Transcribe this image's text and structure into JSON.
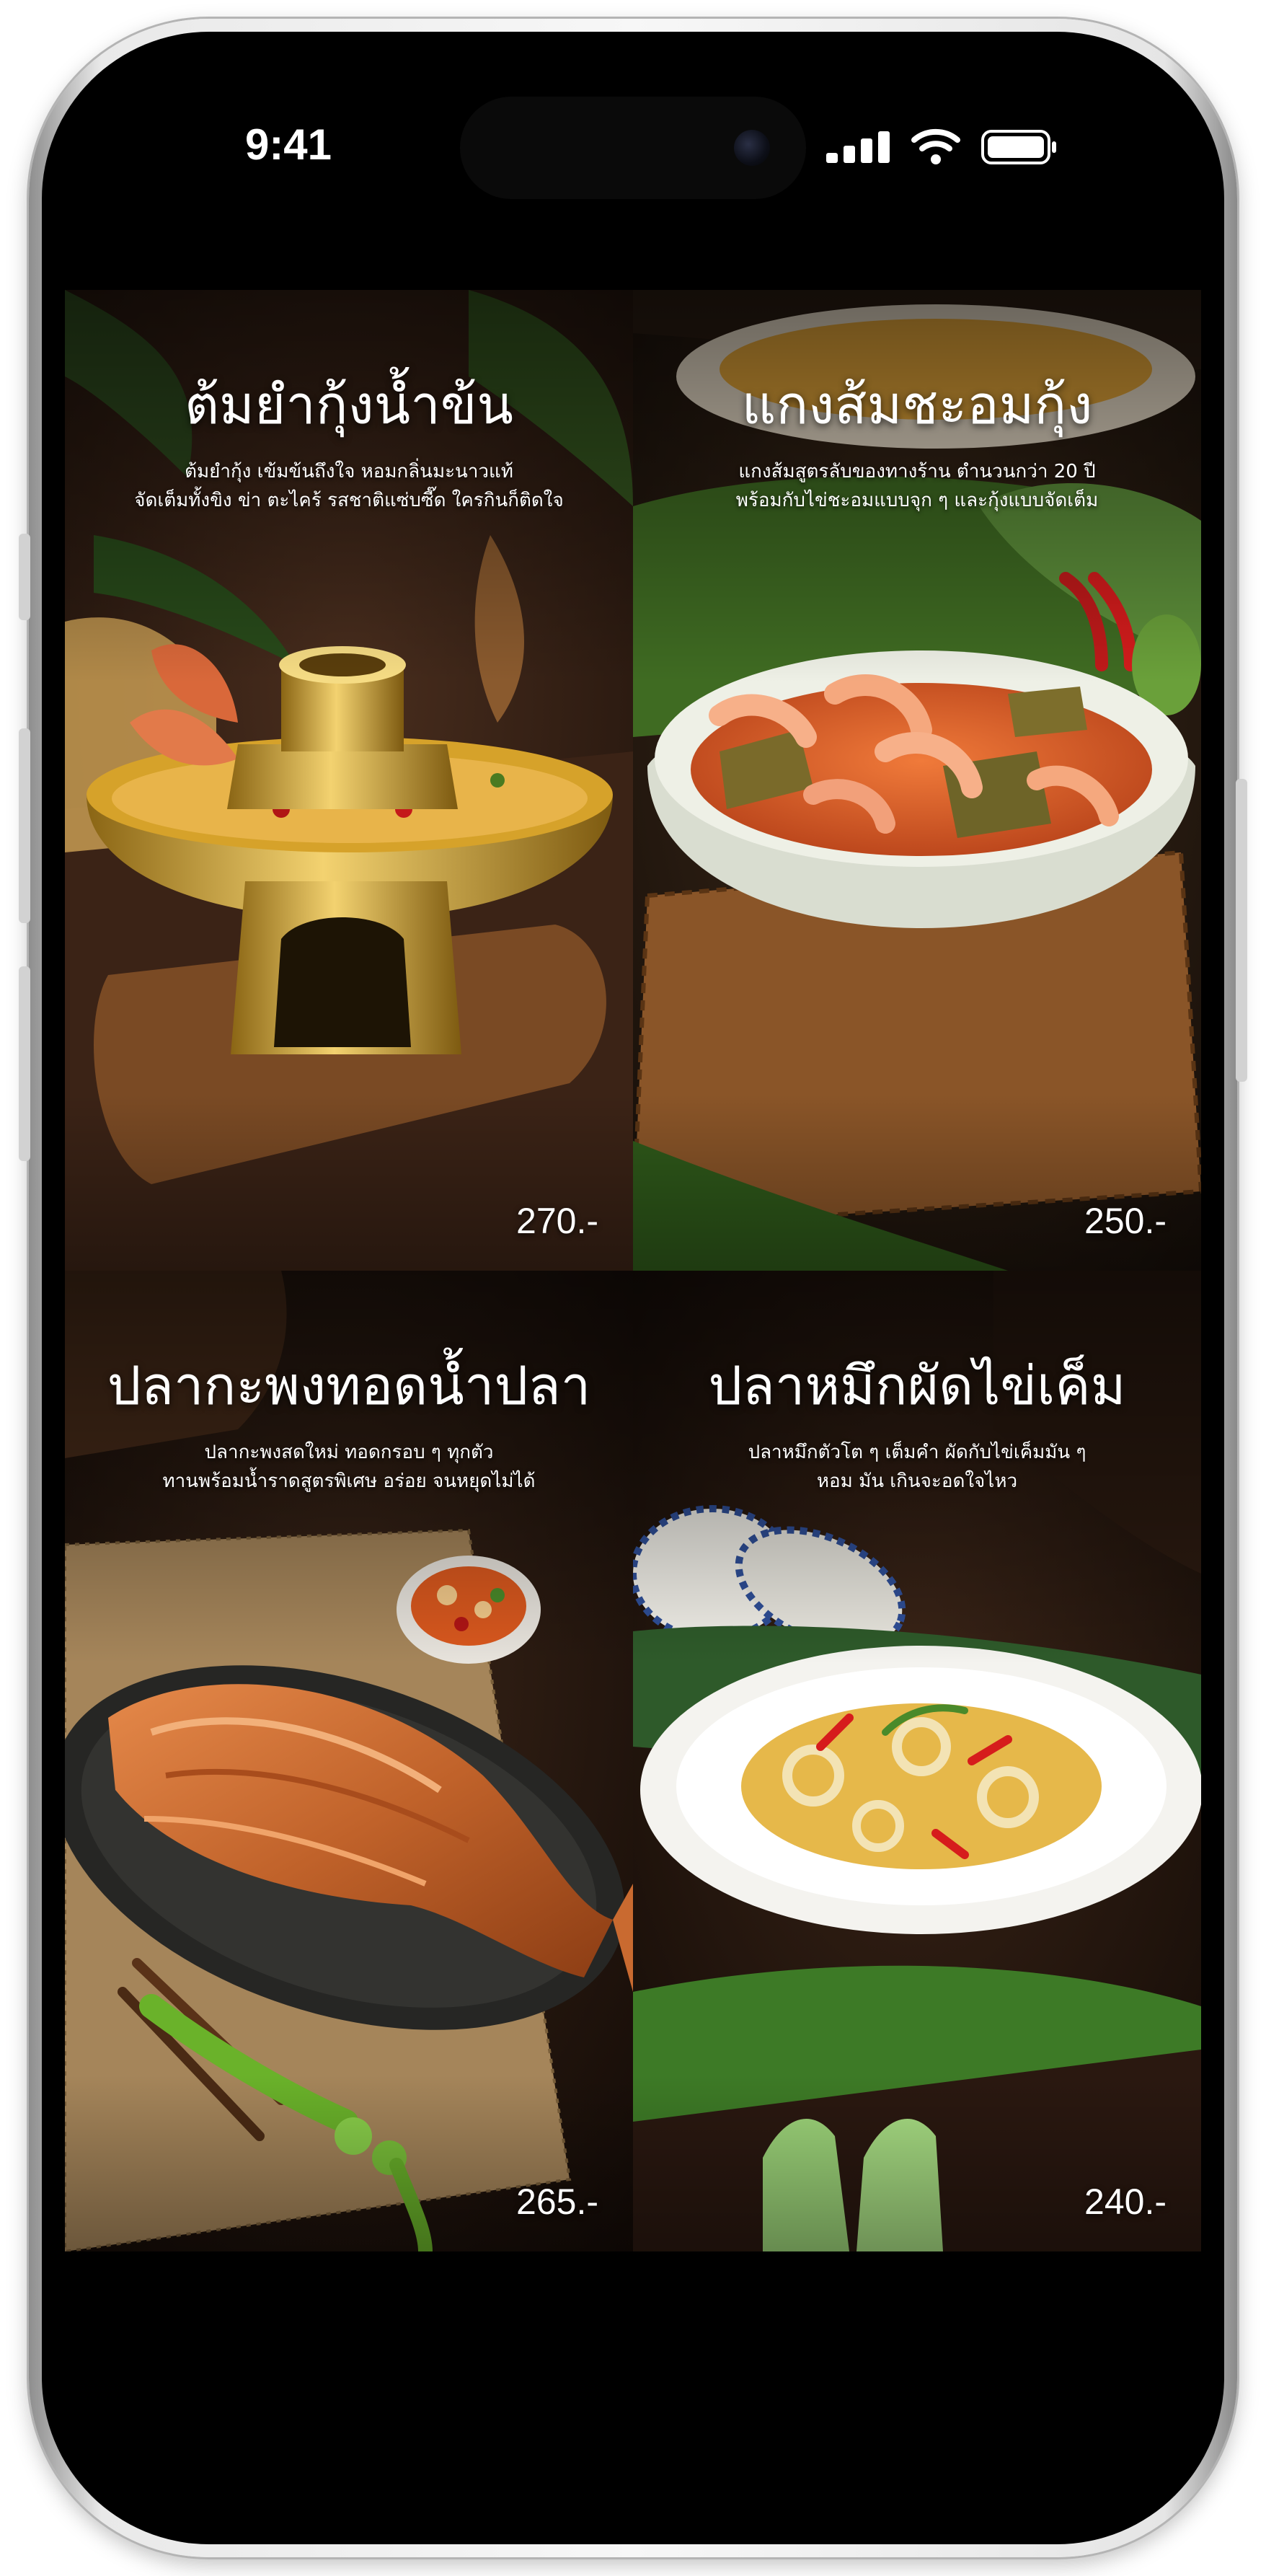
{
  "status_bar": {
    "time": "9:41",
    "icons": [
      "signal-icon",
      "wifi-icon",
      "battery-icon"
    ]
  },
  "menu": {
    "items": [
      {
        "title": "ต้มยำกุ้งน้ำข้น",
        "description": [
          "ต้มยำกุ้ง เข้มข้นถึงใจ หอมกลิ่นมะนาวแท้",
          "จัดเต็มทั้งขิง ข่า ตะไคร้ รสชาติแซ่บซี๊ด ใครกินก็ติดใจ"
        ],
        "price": "270.-"
      },
      {
        "title": "แกงส้มชะอมกุ้ง",
        "description": [
          "แกงส้มสูตรลับของทางร้าน ตำนวนกว่า 20 ปี",
          "พร้อมกับไข่ชะอมแบบจุก ๆ และกุ้งแบบจัดเต็ม"
        ],
        "price": "250.-"
      },
      {
        "title": "ปลากะพงทอดน้ำปลา",
        "description": [
          "ปลากะพงสดใหม่ ทอดกรอบ ๆ ทุกตัว",
          "ทานพร้อมน้ำราดสูตรพิเศษ อร่อย จนหยุดไม่ได้"
        ],
        "price": "265.-"
      },
      {
        "title": "ปลาหมึกผัดไข่เค็ม",
        "description": [
          "ปลาหมึกตัวโต ๆ เต็มคำ ผัดกับไข่เค็มมัน ๆ",
          "หอม มัน เกินจะอดใจไหว"
        ],
        "price": "240.-"
      }
    ]
  },
  "colors": {
    "screen_background": "#000000",
    "text": "#ffffff",
    "phone_frame": "#e9e9e9"
  }
}
